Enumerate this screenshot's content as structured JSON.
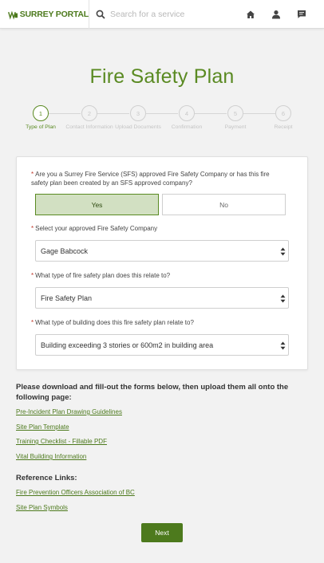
{
  "header": {
    "logo_text": "SURREY PORTAL",
    "search_placeholder": "Search for a service",
    "icons": [
      "home-icon",
      "user-icon",
      "messages-icon"
    ]
  },
  "page": {
    "title": "Fire Safety Plan"
  },
  "stepper": {
    "active_index": 0,
    "steps": [
      {
        "number": "1",
        "label": "Type of Plan"
      },
      {
        "number": "2",
        "label": "Contact Information"
      },
      {
        "number": "3",
        "label": "Upload Documents"
      },
      {
        "number": "4",
        "label": "Confirmation"
      },
      {
        "number": "5",
        "label": "Payment"
      },
      {
        "number": "6",
        "label": "Receipt"
      }
    ]
  },
  "form": {
    "required_marker": "*",
    "q1": {
      "label": "Are you a Surrey Fire Service (SFS) approved Fire Safety Company or has this fire safety plan been created by an SFS approved company?",
      "yes_label": "Yes",
      "no_label": "No",
      "selected": "Yes"
    },
    "q2": {
      "label": "Select your approved Fire Safety Company",
      "value": "Gage Babcock"
    },
    "q3": {
      "label": "What type of fire safety plan does this relate to?",
      "value": "Fire Safety Plan"
    },
    "q4": {
      "label": "What type of building does this fire safety plan relate to?",
      "value": "Building exceeding 3 stories or 600m2 in building area"
    }
  },
  "downloads": {
    "heading": "Please download and fill-out the forms below, then upload them all onto the following page:",
    "links": [
      "Pre-Incident Plan Drawing Guidelines",
      "Site Plan Template",
      "Training Checklist - Fillable PDF",
      "Vital Building Information"
    ]
  },
  "references": {
    "heading": "Reference Links:",
    "links": [
      "Fire Prevention Officers Association of BC",
      "Site Plan Symbols"
    ]
  },
  "actions": {
    "next_label": "Next"
  },
  "colors": {
    "brand_green": "#5a8a22",
    "link_green": "#4d7a1d",
    "yes_selected_bg": "#d2e0c2",
    "page_bg": "#f2f2f2",
    "required": "#c0392b"
  }
}
